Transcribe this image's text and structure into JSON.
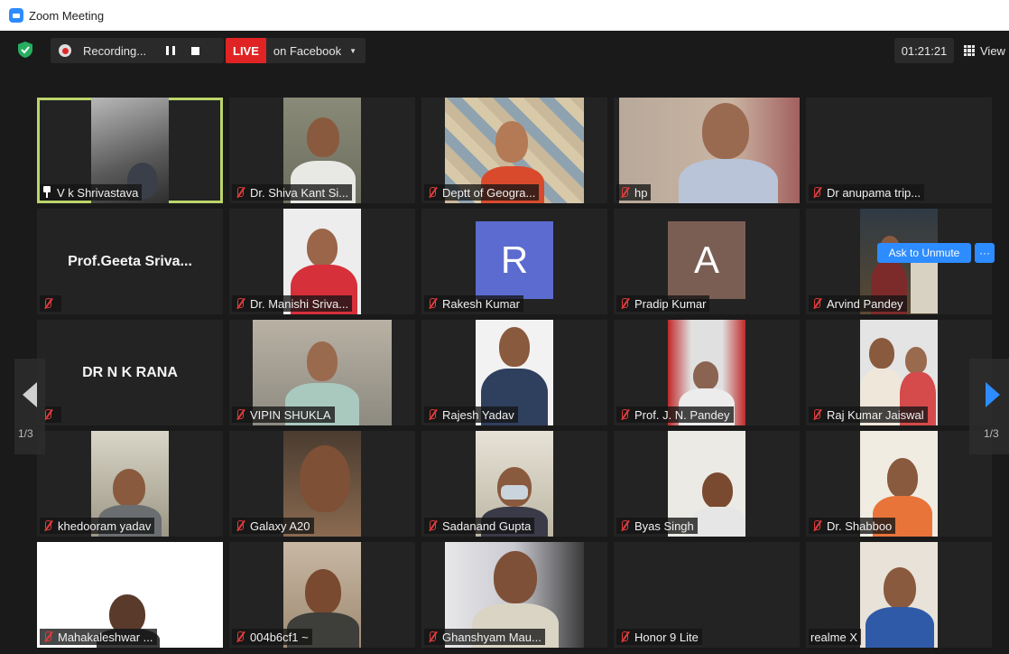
{
  "window": {
    "title": "Zoom Meeting"
  },
  "toolbar": {
    "recording_label": "Recording...",
    "live_label": "LIVE",
    "live_destination": "on Facebook",
    "timer": "01:21:21",
    "view_label": "View"
  },
  "pager": {
    "left": "1/3",
    "right": "1/3"
  },
  "overlay": {
    "ask_unmute": "Ask to Unmute",
    "more": "···"
  },
  "colors": {
    "accent": "#2d8cff",
    "live": "#e02424",
    "active_speaker": "#bcd56a",
    "muted": "#e23b3b"
  },
  "participants": [
    {
      "name": "V k Shrivastava",
      "icon": "pin-icon",
      "active": true
    },
    {
      "name": "Dr. Shiva Kant Si...",
      "icon": "mic-muted-icon"
    },
    {
      "name": "Deptt of Geogra...",
      "icon": "mic-muted-icon"
    },
    {
      "name": "hp",
      "icon": "mic-muted-icon"
    },
    {
      "name": "Dr anupama trip...",
      "icon": "mic-muted-icon"
    },
    {
      "name": "Prof.Geeta  Sriva...",
      "icon": "mic-muted-icon"
    },
    {
      "name": "Dr. Manishi Sriva...",
      "icon": "mic-muted-icon"
    },
    {
      "name": "Rakesh Kumar",
      "icon": "mic-muted-icon",
      "avatar_letter": "R",
      "avatar_color": "#5b6bd0"
    },
    {
      "name": "Pradip Kumar",
      "icon": "mic-muted-icon",
      "avatar_letter": "A",
      "avatar_color": "#7a5e54"
    },
    {
      "name": "Arvind Pandey",
      "icon": "mic-muted-icon"
    },
    {
      "name": "DR N K RANA",
      "icon": "mic-muted-icon"
    },
    {
      "name": "VIPIN SHUKLA",
      "icon": "mic-muted-icon"
    },
    {
      "name": "Rajesh Yadav",
      "icon": "mic-muted-icon"
    },
    {
      "name": "Prof. J. N. Pandey",
      "icon": "mic-muted-icon"
    },
    {
      "name": "Raj Kumar Jaiswal",
      "icon": "mic-muted-icon"
    },
    {
      "name": "khedooram yadav",
      "icon": "mic-muted-icon"
    },
    {
      "name": "Galaxy A20",
      "icon": "mic-muted-icon"
    },
    {
      "name": "Sadanand Gupta",
      "icon": "mic-muted-icon"
    },
    {
      "name": "Byas Singh",
      "icon": "mic-muted-icon"
    },
    {
      "name": "Dr. Shabboo",
      "icon": "mic-muted-icon"
    },
    {
      "name": "Mahakaleshwar ...",
      "icon": "mic-muted-icon"
    },
    {
      "name": "004b6cf1 ~",
      "icon": "mic-muted-icon"
    },
    {
      "name": "Ghanshyam Mau...",
      "icon": "mic-muted-icon"
    },
    {
      "name": "Honor 9 Lite",
      "icon": "mic-muted-icon"
    },
    {
      "name": "realme X",
      "icon": "none"
    }
  ]
}
